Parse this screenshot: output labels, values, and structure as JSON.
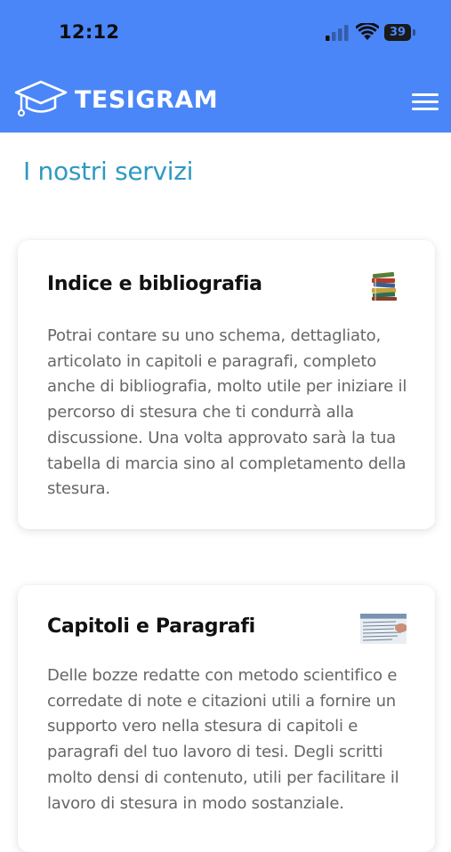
{
  "status_bar": {
    "time": "12:12",
    "battery_percent": "39",
    "battery_level": 0.39,
    "signal_icon": "cellular-signal-icon",
    "wifi_icon": "wifi-icon"
  },
  "header": {
    "brand_name": "TESIGRAM",
    "logo_icon": "graduation-cap-icon",
    "menu_icon": "hamburger-menu-icon",
    "background_color": "#4a86f7"
  },
  "main": {
    "section_title": "I nostri servizi",
    "services": [
      {
        "title": "Indice e bibliografia",
        "icon": "books-stack-icon",
        "text": "Potrai contare su uno schema, dettagliato, articolato in capitoli e paragrafi, completo anche di bibliografia, molto utile per iniziare il percorso di stesura che ti condurrà alla discussione. Una volta approvato sarà la tua tabella di marcia sino al completamento della stesura."
      },
      {
        "title": "Capitoli e Paragrafi",
        "icon": "handwritten-page-icon",
        "text": "Delle bozze redatte con metodo scientifico e corredate di note e citazioni utili a fornire un supporto vero nella stesura di capitoli e paragrafi del tuo lavoro di tesi. Degli scritti molto densi di contenuto, utili per facilitare il lavoro di stesura in modo sostanziale."
      }
    ]
  },
  "colors": {
    "accent": "#2f99c2",
    "header": "#4a86f7"
  }
}
